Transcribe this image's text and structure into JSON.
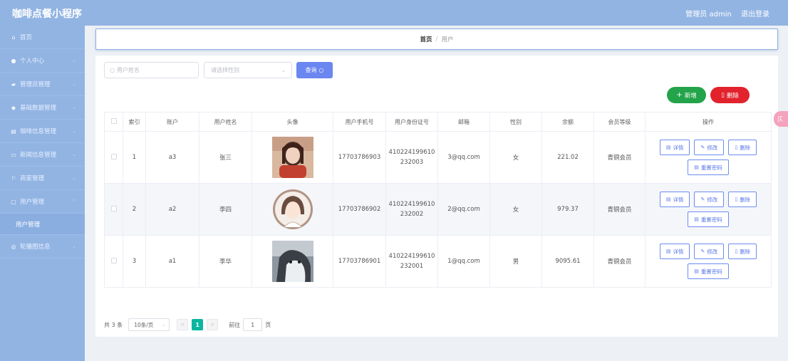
{
  "app": {
    "title": "咖啡点餐小程序"
  },
  "topbar": {
    "user_label": "管理员 admin",
    "logout": "退出登录"
  },
  "sidebar": {
    "items": [
      {
        "label": "首页",
        "icon": "home-icon"
      },
      {
        "label": "个人中心",
        "icon": "person-icon"
      },
      {
        "label": "管理员管理",
        "icon": "admin-icon"
      },
      {
        "label": "基础数据管理",
        "icon": "data-icon"
      },
      {
        "label": "咖啡信息管理",
        "icon": "coffee-icon"
      },
      {
        "label": "新闻信息管理",
        "icon": "news-icon"
      },
      {
        "label": "商家管理",
        "icon": "store-icon"
      },
      {
        "label": "用户管理",
        "icon": "users-icon"
      },
      {
        "label": "轮播图信息",
        "icon": "carousel-icon"
      }
    ],
    "sub_item": "用户管理"
  },
  "breadcrumb": {
    "home": "首页",
    "separator": "/",
    "current": "用户"
  },
  "search": {
    "name_placeholder": "用户姓名",
    "sex_placeholder": "请选择性别",
    "query_button": "查询"
  },
  "actions": {
    "add": "新增",
    "delete": "删除"
  },
  "table": {
    "headers": [
      "索引",
      "账户",
      "用户姓名",
      "头像",
      "用户手机号",
      "用户身份证号",
      "邮箱",
      "性别",
      "余额",
      "会员等级",
      "操作"
    ],
    "rows": [
      {
        "index": "1",
        "account": "a3",
        "name": "张三",
        "avatar": "photo-girl-red",
        "phone": "17703786903",
        "id_line1": "410224199610",
        "id_line2": "232003",
        "email": "3@qq.com",
        "sex": "女",
        "balance": "221.02",
        "level": "青铜会员"
      },
      {
        "index": "2",
        "account": "a2",
        "name": "李四",
        "avatar": "illustration-girl",
        "phone": "17703786902",
        "id_line1": "410224199610",
        "id_line2": "232002",
        "email": "2@qq.com",
        "sex": "女",
        "balance": "979.37",
        "level": "青铜会员"
      },
      {
        "index": "3",
        "account": "a1",
        "name": "李华",
        "avatar": "photo-husky-dog",
        "phone": "17703786901",
        "id_line1": "410224199610",
        "id_line2": "232001",
        "email": "1@qq.com",
        "sex": "男",
        "balance": "9095.61",
        "level": "青铜会员"
      }
    ],
    "op_labels": {
      "detail": "详情",
      "edit": "修改",
      "delete": "删除",
      "reset": "重置密码"
    }
  },
  "pagination": {
    "total": "共 3 条",
    "page_size": "10条/页",
    "current_page": "1",
    "goto_label": "前往",
    "goto_value": "1",
    "page_unit": "页"
  },
  "float_tab": {
    "label": "仄"
  },
  "colors": {
    "header": "#92b4e3",
    "primary": "#6a86f0",
    "success": "#23a44a",
    "danger": "#e2222c",
    "pager": "#0bb6a1"
  }
}
